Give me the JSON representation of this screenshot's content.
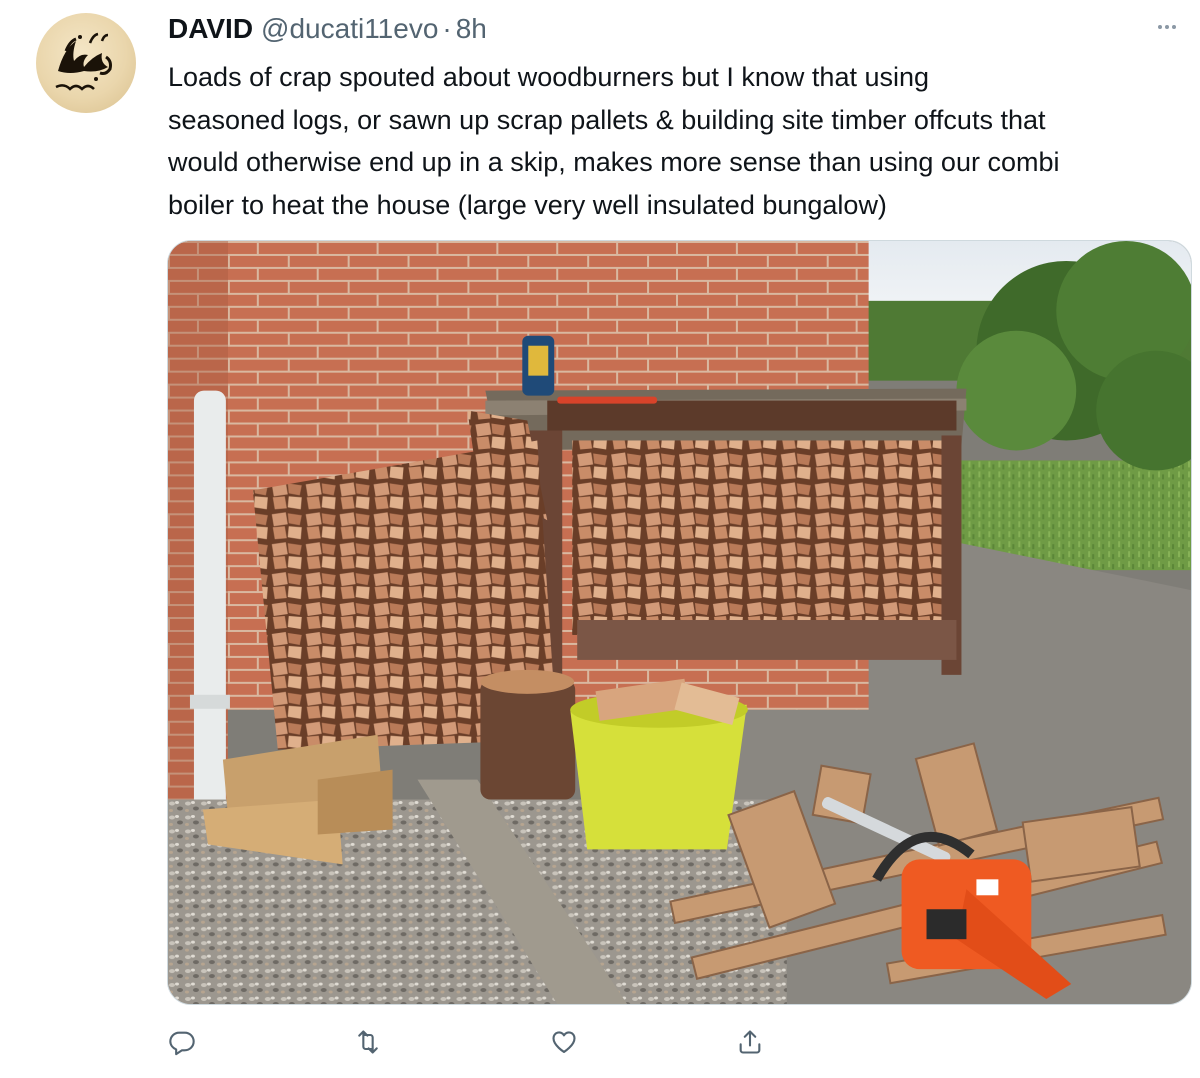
{
  "author": {
    "display_name": "DAVID",
    "handle": "@ducati11evo",
    "separator": "·",
    "time_ago": "8h",
    "avatar_icon": "calligraphy-avatar-icon"
  },
  "tweet": {
    "text_lines": [
      "Loads of crap spouted about woodburners but I know that using",
      "seasoned logs, or sawn up scrap pallets & building site timber offcuts that",
      "would otherwise end up in a skip, makes more sense than using our combi",
      "boiler to heat the house (large very well insulated bungalow)"
    ]
  },
  "media": {
    "photo_icon": "woodpile-photo"
  },
  "actions": {
    "reply_icon": "reply-icon",
    "retweet_icon": "retweet-icon",
    "like_icon": "heart-icon",
    "share_icon": "share-icon",
    "more_icon": "more-icon"
  },
  "colors": {
    "text_primary": "#0f1419",
    "text_secondary": "#536471",
    "icon_gray": "#536471"
  }
}
